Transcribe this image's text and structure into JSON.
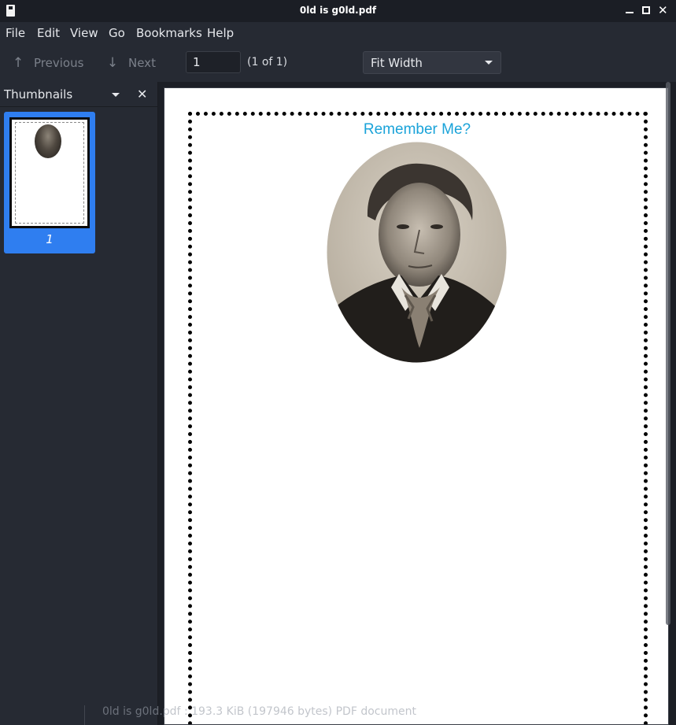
{
  "window": {
    "title": "0ld is g0ld.pdf"
  },
  "menu": [
    "File",
    "Edit",
    "View",
    "Go",
    "Bookmarks",
    "Help"
  ],
  "toolbar": {
    "previous_label": "Previous",
    "next_label": "Next",
    "page_value": "1",
    "page_count": "(1 of 1)",
    "zoom_value": "Fit Width"
  },
  "sidebar": {
    "title": "Thumbnails",
    "thumbnail_label": "1"
  },
  "document": {
    "heading": "Remember Me?"
  },
  "status": {
    "text": "0ld is g0ld.pdf : 193.3 KiB (197946 bytes) PDF document"
  }
}
